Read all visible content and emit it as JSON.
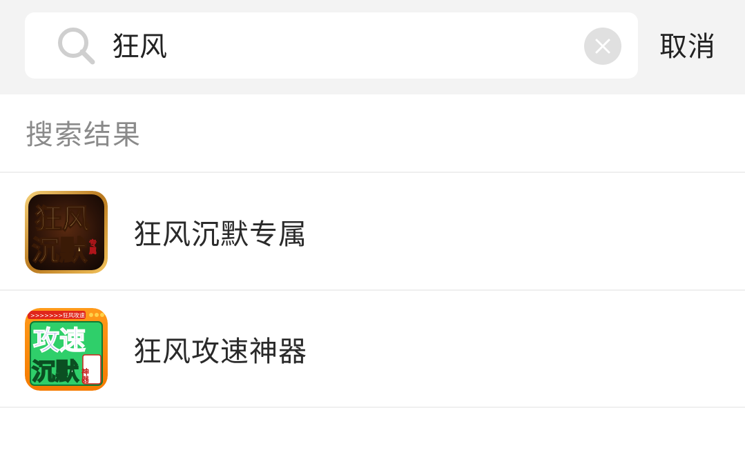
{
  "search": {
    "value": "狂风",
    "clear_icon": "clear-icon",
    "search_icon": "search-icon"
  },
  "header": {
    "cancel_label": "取消"
  },
  "section": {
    "title": "搜索结果"
  },
  "results": [
    {
      "name": "狂风沉默专属",
      "icon": "app-icon-kuangfeng-chenmo-zhuanshu",
      "icon_text": [
        "狂风",
        "沉默",
        "专属"
      ]
    },
    {
      "name": "狂风攻速神器",
      "icon": "app-icon-kuangfeng-gongsu-shenqi",
      "icon_text": [
        ">>>>>>>狂风攻速",
        "攻速",
        "沉默",
        "神器"
      ]
    }
  ],
  "colors": {
    "topbar_bg": "#f3f3f3",
    "section_text": "#8a8a8a",
    "primary_text": "#222222"
  }
}
